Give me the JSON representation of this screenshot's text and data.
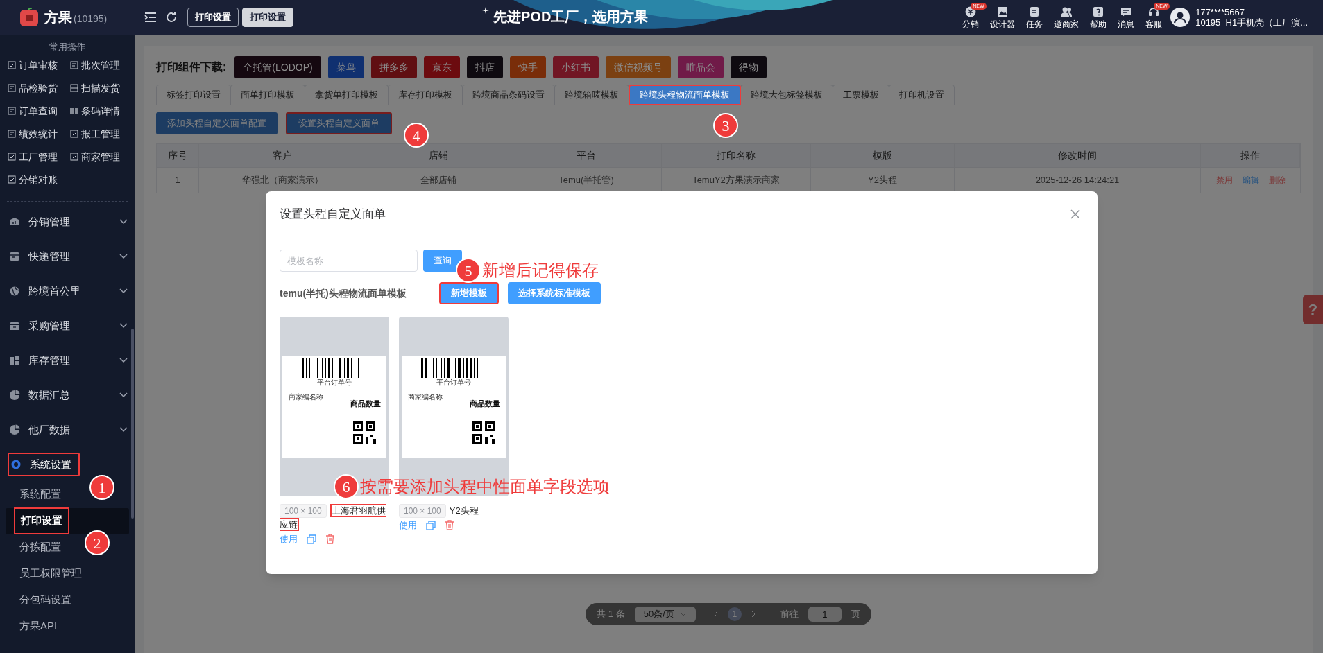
{
  "app": {
    "name": "方果",
    "account": "(10195)"
  },
  "top_bar": {
    "breadcrumbs": [
      {
        "label": "打印设置",
        "selected": false
      },
      {
        "label": "打印设置",
        "selected": true
      }
    ],
    "slogan": "先进POD工厂，选用方果",
    "tools": [
      {
        "label": "分销",
        "badge": "NEW"
      },
      {
        "label": "设计器"
      },
      {
        "label": "任务"
      },
      {
        "label": "邀商家"
      },
      {
        "label": "帮助"
      },
      {
        "label": "消息"
      },
      {
        "label": "客服",
        "badge": "NEW"
      }
    ],
    "user": {
      "phone": "177****5667",
      "company": "10195  H1手机壳（工厂演..."
    }
  },
  "sidebar": {
    "section_title": "常用操作",
    "shortcuts": [
      "订单审核",
      "批次管理",
      "品检验货",
      "扫描发货",
      "订单查询",
      "条码详情",
      "绩效统计",
      "报工管理",
      "工厂管理",
      "商家管理",
      "分销对账"
    ],
    "menus": [
      {
        "label": "分销管理",
        "expanded": false,
        "highlighted": false
      },
      {
        "label": "快递管理",
        "expanded": false,
        "highlighted": false
      },
      {
        "label": "跨境首公里",
        "expanded": false,
        "highlighted": false
      },
      {
        "label": "采购管理",
        "expanded": false,
        "highlighted": false
      },
      {
        "label": "库存管理",
        "expanded": false,
        "highlighted": false
      },
      {
        "label": "数据汇总",
        "expanded": false,
        "highlighted": false
      },
      {
        "label": "他厂数据",
        "expanded": false,
        "highlighted": false
      },
      {
        "label": "系统设置",
        "expanded": true,
        "highlighted": true,
        "children": [
          {
            "label": "系统配置",
            "selected": false,
            "highlighted": false
          },
          {
            "label": "打印设置",
            "selected": true,
            "highlighted": true
          },
          {
            "label": "分拣配置",
            "selected": false,
            "highlighted": false
          },
          {
            "label": "员工权限管理",
            "selected": false,
            "highlighted": false
          },
          {
            "label": "分包码设置",
            "selected": false,
            "highlighted": false
          },
          {
            "label": "方果API",
            "selected": false,
            "highlighted": false
          }
        ]
      }
    ]
  },
  "main": {
    "download_label": "打印组件下载:",
    "download_buttons": [
      {
        "label": "全托管(LODOP)",
        "color": "#150810"
      },
      {
        "label": "菜鸟",
        "color": "#103070"
      },
      {
        "label": "拼多多",
        "color": "#600f12"
      },
      {
        "label": "京东",
        "color": "#6c0b0f"
      },
      {
        "label": "抖店",
        "color": "#0e0a10"
      },
      {
        "label": "快手",
        "color": "#792d09"
      },
      {
        "label": "小红书",
        "color": "#711624"
      },
      {
        "label": "微信视频号",
        "color": "#7b4011"
      },
      {
        "label": "唯品会",
        "color": "#701a48"
      },
      {
        "label": "得物",
        "color": "#0e0a10"
      }
    ],
    "tabs": [
      {
        "label": "标签打印设置",
        "selected": false,
        "highlighted": false
      },
      {
        "label": "面单打印模板",
        "selected": false,
        "highlighted": false
      },
      {
        "label": "拿货单打印模板",
        "selected": false,
        "highlighted": false
      },
      {
        "label": "库存打印模板",
        "selected": false,
        "highlighted": false
      },
      {
        "label": "跨境商品条码设置",
        "selected": false,
        "highlighted": false
      },
      {
        "label": "跨境箱唛模板",
        "selected": false,
        "highlighted": false
      },
      {
        "label": "跨境头程物流面单模板",
        "selected": true,
        "highlighted": true
      },
      {
        "label": "跨境大包标签模板",
        "selected": false,
        "highlighted": false
      },
      {
        "label": "工票模板",
        "selected": false,
        "highlighted": false
      },
      {
        "label": "打印机设置",
        "selected": false,
        "highlighted": false
      }
    ],
    "actions": [
      {
        "label": "添加头程自定义面单配置",
        "highlighted": false
      },
      {
        "label": "设置头程自定义面单",
        "highlighted": true
      }
    ],
    "table": {
      "columns": [
        "序号",
        "客户",
        "店铺",
        "平台",
        "打印名称",
        "模版",
        "修改时间",
        "操作"
      ],
      "rows": [
        {
          "cells": [
            "1",
            "华强北（商家演示）",
            "全部店铺",
            "Temu(半托管)",
            "TemuY2方果演示商家",
            "Y2头程",
            "2025-12-26 14:24:21"
          ],
          "actions": [
            {
              "label": "禁用",
              "kind": "danger"
            },
            {
              "label": "编辑",
              "kind": "primary"
            },
            {
              "label": "删除",
              "kind": "danger"
            }
          ]
        }
      ]
    },
    "pagination": {
      "total": "共 1 条",
      "page_size": "50条/页",
      "current_page": "1",
      "goto_label": "前往",
      "goto_value": "1",
      "page_unit": "页"
    }
  },
  "help_tab": {
    "label": "?"
  },
  "modal": {
    "title": "设置头程自定义面单",
    "search": {
      "placeholder": "模板名称"
    },
    "search_button": "查询",
    "section_label": "temu(半托)头程物流面单模板",
    "buttons": [
      {
        "label": "新增模板",
        "highlighted": true
      },
      {
        "label": "选择系统标准模板",
        "highlighted": false
      }
    ],
    "templates": [
      {
        "preview": {
          "barcode_caption": "平台订单号",
          "merchant": "商家编名称",
          "quantity": "商品数量"
        },
        "size": "100 × 100",
        "name": "上海君羽航供应链",
        "highlighted": true,
        "use_label": "使用"
      },
      {
        "preview": {
          "barcode_caption": "平台订单号",
          "merchant": "商家编名称",
          "quantity": "商品数量"
        },
        "size": "100 × 100",
        "name": "Y2头程",
        "highlighted": false,
        "use_label": "使用"
      }
    ]
  },
  "annotations": [
    {
      "number": "1"
    },
    {
      "number": "2"
    },
    {
      "number": "3"
    },
    {
      "number": "4"
    },
    {
      "number": "5",
      "note": "新增后记得保存"
    },
    {
      "number": "6",
      "note": "按需要添加头程中性面单字段选项"
    }
  ]
}
